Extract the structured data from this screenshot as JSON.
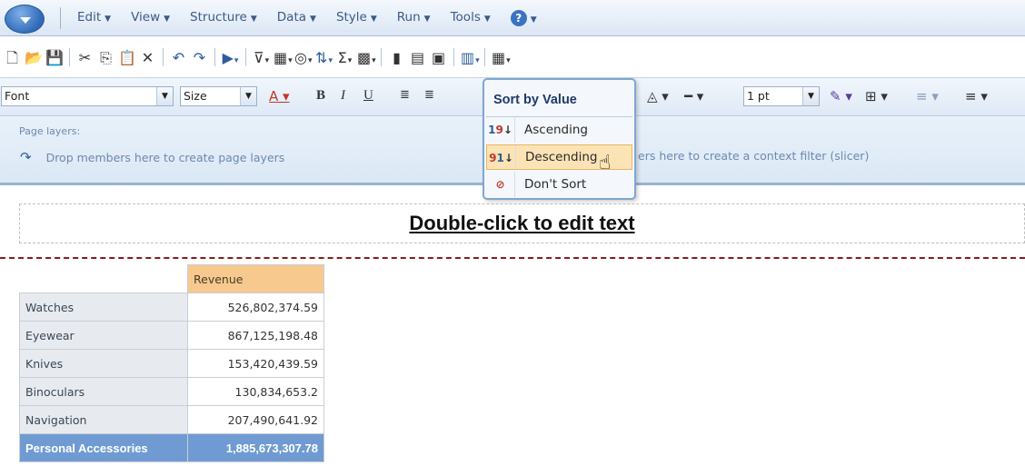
{
  "menu": {
    "items": [
      {
        "label": "Edit"
      },
      {
        "label": "View"
      },
      {
        "label": "Structure"
      },
      {
        "label": "Data"
      },
      {
        "label": "Style"
      },
      {
        "label": "Run"
      },
      {
        "label": "Tools"
      }
    ],
    "help_label": "?"
  },
  "format_toolbar": {
    "font_value": "Font",
    "size_value": "Size",
    "border_width_value": "1 pt"
  },
  "page_layers": {
    "label": "Page layers:",
    "hint": "Drop members here to create page layers",
    "slicer_hint": "ers here to create a context filter (slicer)"
  },
  "report": {
    "title": "Double-click to edit text"
  },
  "crosstab": {
    "column_header": "Revenue",
    "rows": [
      {
        "label": "Watches",
        "value": "526,802,374.59"
      },
      {
        "label": "Eyewear",
        "value": "867,125,198.48"
      },
      {
        "label": "Knives",
        "value": "153,420,439.59"
      },
      {
        "label": "Binoculars",
        "value": "130,834,653.2"
      },
      {
        "label": "Navigation",
        "value": "207,490,641.92"
      }
    ],
    "total": {
      "label": "Personal Accessories",
      "value": "1,885,673,307.78"
    }
  },
  "sort_menu": {
    "title": "Sort by Value",
    "items": [
      {
        "label": "Ascending",
        "icon": "sort-ascending-icon"
      },
      {
        "label": "Descending",
        "icon": "sort-descending-icon"
      },
      {
        "label": "Don't Sort",
        "icon": "no-sort-icon"
      }
    ],
    "hovered": "Descending"
  },
  "colors": {
    "accent": "#2c5d9e",
    "column_header_bg": "#f7c98e",
    "total_bg": "#6f9bd2",
    "page_break": "#8b1a1a"
  }
}
